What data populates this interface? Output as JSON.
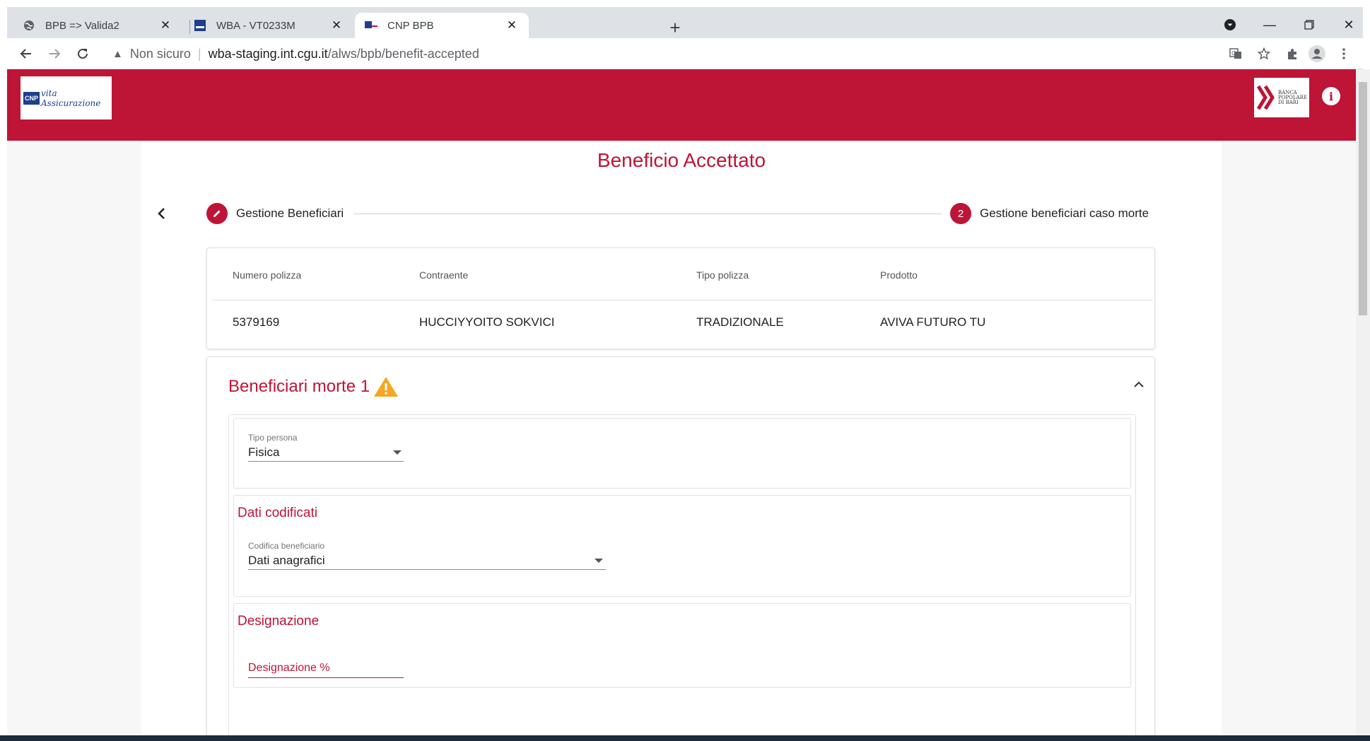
{
  "browser": {
    "tabs": [
      {
        "title": "BPB => Valida2",
        "favicon": "globe-icon",
        "active": false
      },
      {
        "title": "WBA - VT0233M",
        "favicon": "cnp-favicon",
        "active": false
      },
      {
        "title": "CNP BPB",
        "favicon": "cnp-flag-favicon",
        "active": true
      }
    ],
    "omnibox": {
      "security": "Non sicuro",
      "host": "wba-staging.int.cgu.it",
      "path": "/alws/bpb/benefit-accepted"
    }
  },
  "app": {
    "header": {
      "accent": "#be1436",
      "logo_left_cnp": "CNP",
      "logo_left_script": "vita Assicurazione",
      "logo_right_text": [
        "BANCA",
        "POPOLARE",
        "DI BARI"
      ]
    },
    "page_title": "Beneficio Accettato",
    "stepper": {
      "steps": [
        {
          "number": "",
          "icon": "pencil-icon",
          "label": "Gestione Beneficiari"
        },
        {
          "number": "2",
          "label": "Gestione beneficiari caso morte"
        }
      ]
    },
    "policy": {
      "headers": [
        "Numero polizza",
        "Contraente",
        "Tipo polizza",
        "Prodotto"
      ],
      "values": [
        "5379169",
        "HUCCIYYOITO SOKVICI",
        "TRADIZIONALE",
        "AVIVA FUTURO TU"
      ]
    },
    "beneficiari": {
      "title": "Beneficiari morte 1",
      "tipo_persona": {
        "label": "Tipo persona",
        "value": "Fisica"
      },
      "dati_codificati": {
        "title": "Dati codificati",
        "codifica": {
          "label": "Codifica beneficiario",
          "value": "Dati anagrafici"
        }
      },
      "designazione": {
        "title": "Designazione",
        "percent_label": "Designazione %"
      }
    }
  }
}
